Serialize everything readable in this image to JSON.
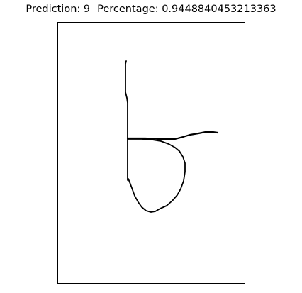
{
  "title": {
    "prediction_label": "Prediction: 9",
    "percentage_label": "Percentage: 0.9448840453213363"
  },
  "figure": {
    "background_color": "#ffffff",
    "stroke_color": "#000000",
    "axes_border_color": "#000000",
    "axes_ticks_visible": false
  }
}
